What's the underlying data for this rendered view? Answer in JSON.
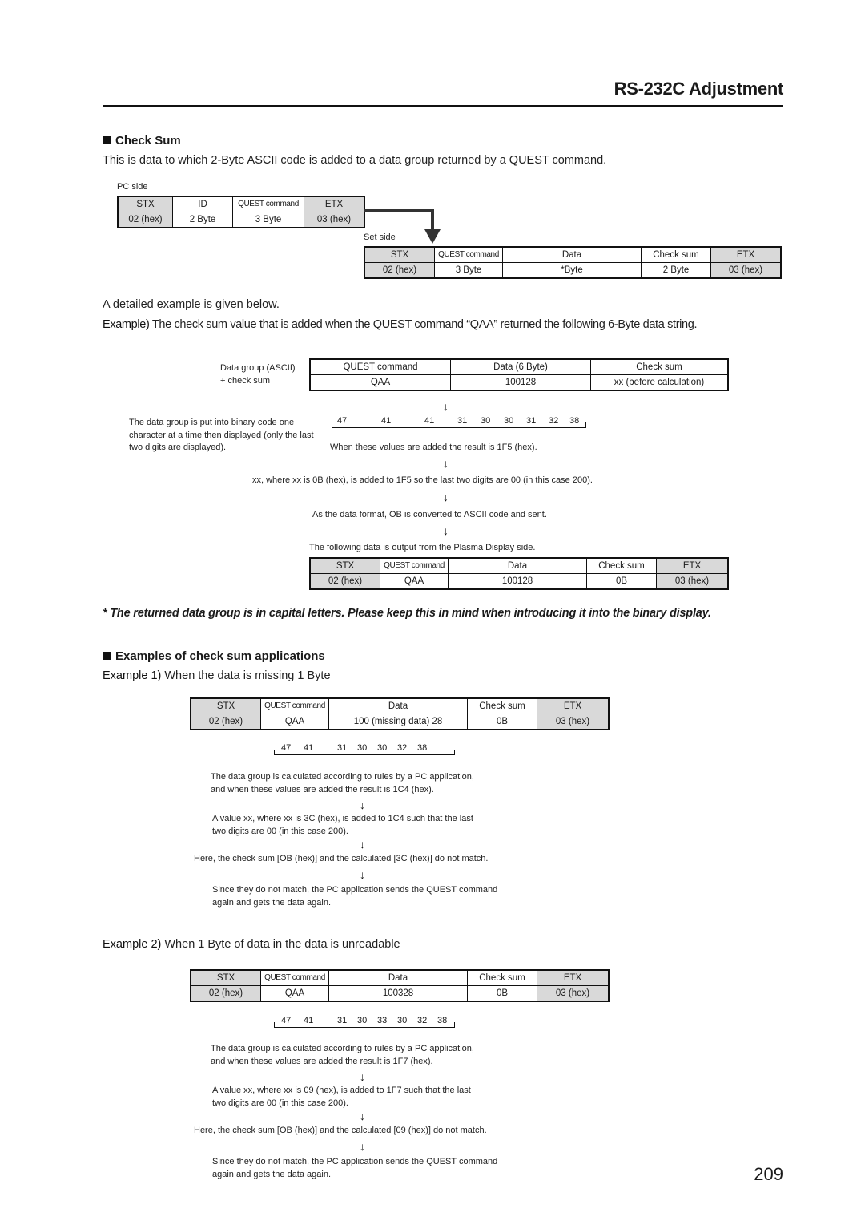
{
  "header": {
    "title": "RS-232C Adjustment",
    "page_number": "209"
  },
  "check_sum": {
    "heading": "Check Sum",
    "intro": "This is data to which 2-Byte ASCII code is added to a data group returned by a QUEST command.",
    "pc_side_label": "PC side",
    "pc_table": {
      "headers": [
        "STX",
        "ID",
        "QUEST command",
        "ETX"
      ],
      "values": [
        "02 (hex)",
        "2 Byte",
        "3 Byte",
        "03 (hex)"
      ]
    },
    "set_side_label": "Set side",
    "set_table": {
      "headers": [
        "STX",
        "QUEST command",
        "Data",
        "Check sum",
        "ETX"
      ],
      "values": [
        "02 (hex)",
        "3 Byte",
        "*Byte",
        "2 Byte",
        "03 (hex)"
      ]
    },
    "detail_intro": "A detailed example is given below.",
    "example_label": "Example)",
    "example_text": "The check sum value that is added when the QUEST command “QAA” returned the following 6-Byte data string.",
    "data_group_label_1": "Data group (ASCII)",
    "data_group_label_2": "+ check sum",
    "group_table": {
      "headers": [
        "QUEST command",
        "Data (6 Byte)",
        "Check sum"
      ],
      "values": [
        "QAA",
        "100128",
        "xx (before calculation)"
      ]
    },
    "binary_note": "The data group is put into binary code one character at a time then displayed (only the last two digits are displayed).",
    "hex_values": [
      "47",
      "41",
      "41",
      "31",
      "30",
      "30",
      "31",
      "32",
      "38"
    ],
    "sum_text": "When these values are added the result is 1F5 (hex).",
    "step_1": "xx, where xx is 0B (hex), is added to 1F5 so the last two digits are 00 (in this case 200).",
    "step_2": "As the data format, OB is converted to ASCII code and sent.",
    "step_3": "The following data is output from the Plasma Display side.",
    "output_table": {
      "headers": [
        "STX",
        "QUEST command",
        "Data",
        "Check sum",
        "ETX"
      ],
      "values": [
        "02 (hex)",
        "QAA",
        "100128",
        "0B",
        "03 (hex)"
      ]
    },
    "note": "* The returned data group is in capital letters. Please keep this in mind when introducing it into the binary display."
  },
  "applications": {
    "heading": "Examples of check sum applications",
    "examples": [
      {
        "label": "Example 1)",
        "title": "When the data is missing 1 Byte",
        "table": {
          "headers": [
            "STX",
            "QUEST command",
            "Data",
            "Check sum",
            "ETX"
          ],
          "values": [
            "02 (hex)",
            "QAA",
            "100 (missing data) 28",
            "0B",
            "03 (hex)"
          ]
        },
        "hex_values": [
          "47",
          "41",
          "31",
          "30",
          "30",
          "32",
          "38"
        ],
        "calc_text_1": "The data group is calculated according to rules by a PC application,",
        "calc_text_2": "and when these values are added the result is 1C4 (hex).",
        "step_1a": "A value xx, where xx is 3C (hex), is added to 1C4 such that the last",
        "step_1b": "two digits are 00 (in this case 200).",
        "step_2": "Here, the check sum [OB (hex)] and the calculated [3C (hex)] do not match.",
        "step_3a": "Since they do not match, the PC application sends the QUEST command",
        "step_3b": "again and gets the data again."
      },
      {
        "label": "Example 2)",
        "title": "When 1 Byte of data in the data is unreadable",
        "table": {
          "headers": [
            "STX",
            "QUEST command",
            "Data",
            "Check sum",
            "ETX"
          ],
          "values": [
            "02 (hex)",
            "QAA",
            "100328",
            "0B",
            "03 (hex)"
          ]
        },
        "hex_values": [
          "47",
          "41",
          "31",
          "30",
          "33",
          "30",
          "32",
          "38"
        ],
        "calc_text_1": "The data group is calculated according to rules by a PC application,",
        "calc_text_2": "and when these values are added the result is 1F7 (hex).",
        "step_1a": "A value xx, where xx is 09 (hex), is added to 1F7 such that the last",
        "step_1b": "two digits are 00 (in this case 200).",
        "step_2": "Here, the check sum [OB (hex)] and the calculated [09 (hex)] do not match.",
        "step_3a": "Since they do not match, the PC application sends the QUEST command",
        "step_3b": "again and gets the data again."
      }
    ]
  },
  "icons": {
    "arrow_down": "↓",
    "bullet": "black-square"
  }
}
